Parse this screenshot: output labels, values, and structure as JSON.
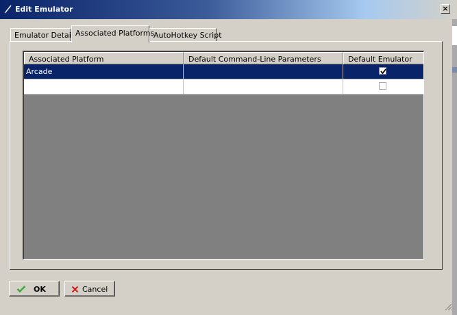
{
  "window": {
    "title": "Edit Emulator"
  },
  "tabs": [
    {
      "label": "Emulator Details"
    },
    {
      "label": "Associated Platforms"
    },
    {
      "label": "AutoHotkey Script"
    }
  ],
  "grid": {
    "columns": [
      "Associated Platform",
      "Default Command-Line Parameters",
      "Default Emulator"
    ],
    "rows": [
      {
        "platform": "Arcade",
        "params": "",
        "default": true
      },
      {
        "platform": "",
        "params": "",
        "default": false
      }
    ]
  },
  "buttons": {
    "ok": "OK",
    "cancel": "Cancel"
  },
  "colors": {
    "selection": "#0a246a",
    "ok_icon": "#3aa83a",
    "cancel_icon": "#d02020"
  }
}
